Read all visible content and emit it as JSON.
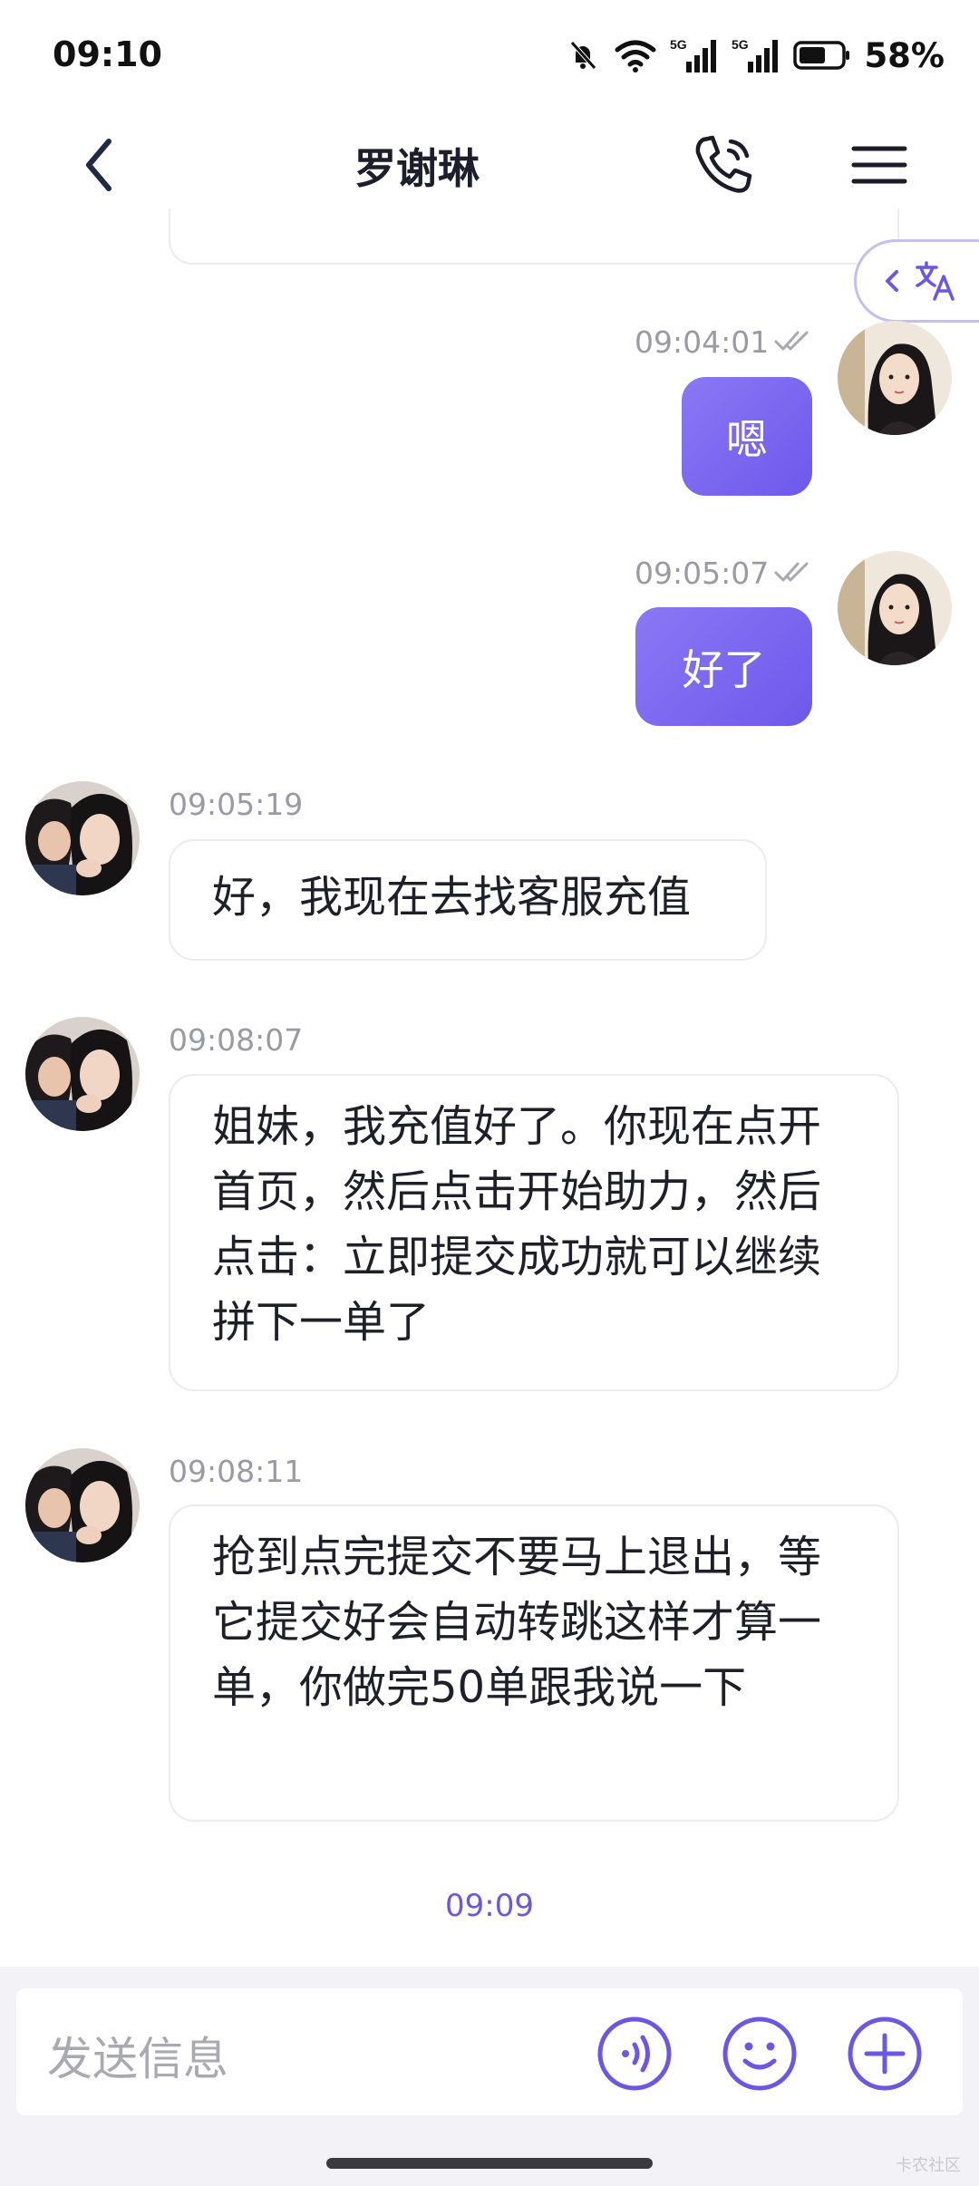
{
  "status_bar": {
    "time": "09:10",
    "battery": "58%",
    "icons": [
      "mute-bell-icon",
      "wifi-icon",
      "signal-5g-icon",
      "signal-5g-icon",
      "battery-icon"
    ]
  },
  "header": {
    "title": "罗谢琳",
    "back_icon": "chevron-left-icon",
    "call_icon": "phone-icon",
    "menu_icon": "hamburger-menu-icon"
  },
  "translate_tab": {
    "icon": "translate-icon"
  },
  "messages": [
    {
      "direction": "outgoing",
      "time": "09:04:01",
      "status": "double-check",
      "text": "嗯"
    },
    {
      "direction": "outgoing",
      "time": "09:05:07",
      "status": "double-check",
      "text": "好了"
    },
    {
      "direction": "incoming",
      "time": "09:05:19",
      "text": "好，我现在去找客服充值"
    },
    {
      "direction": "incoming",
      "time": "09:08:07",
      "text": "姐妹，我充值好了。你现在点开首页，然后点击开始助力，然后点击：立即提交成功就可以继续拼下一单了"
    },
    {
      "direction": "incoming",
      "time": "09:08:11",
      "text": "抢到点完提交不要马上退出，等它提交好会自动转跳这样才算一单，你做完50单跟我说一下"
    }
  ],
  "center_time": "09:09",
  "input": {
    "placeholder": "发送信息",
    "voice_icon": "voice-icon",
    "emoji_icon": "emoji-icon",
    "add_icon": "plus-icon"
  },
  "colors": {
    "accent": "#7460ee",
    "bubble_out": "#7b67f0",
    "text": "#1f1f2a"
  },
  "watermark": "卡农社区"
}
